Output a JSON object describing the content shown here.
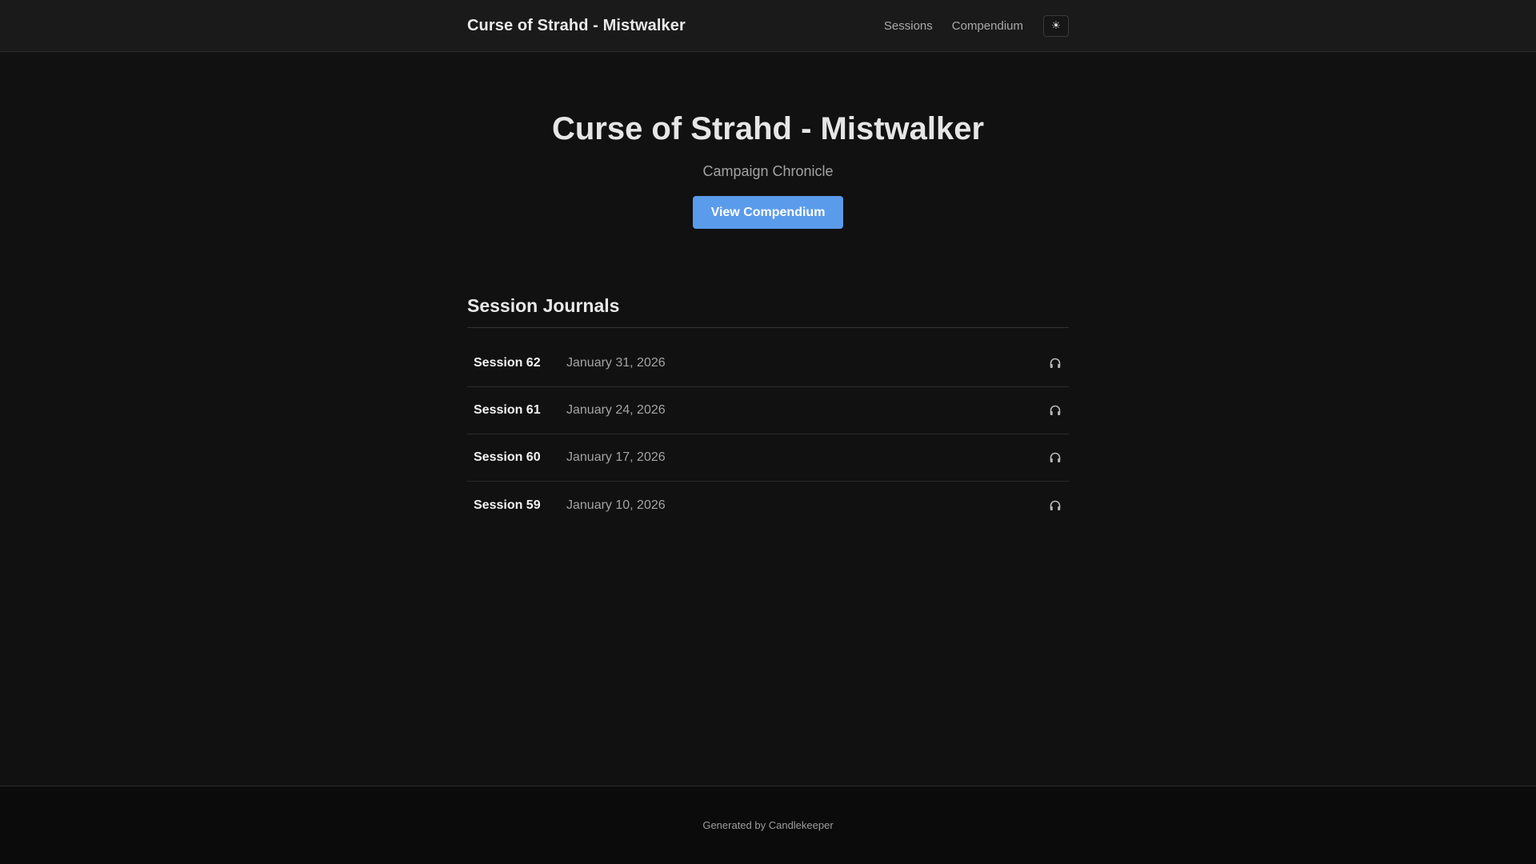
{
  "header": {
    "brand": "Curse of Strahd - Mistwalker",
    "nav": [
      "Sessions",
      "Compendium"
    ],
    "theme_toggle_icon": "sun-icon",
    "theme_toggle_glyph": "☀"
  },
  "hero": {
    "title": "Curse of Strahd - Mistwalker",
    "subtitle": "Campaign Chronicle",
    "cta_label": "View Compendium"
  },
  "journals": {
    "heading": "Session Journals",
    "sessions": [
      {
        "name": "Session 62",
        "date": "January 31, 2026",
        "icon": "headphones-icon"
      },
      {
        "name": "Session 61",
        "date": "January 24, 2026",
        "icon": "headphones-icon"
      },
      {
        "name": "Session 60",
        "date": "January 17, 2026",
        "icon": "headphones-icon"
      },
      {
        "name": "Session 59",
        "date": "January 10, 2026",
        "icon": "headphones-icon"
      }
    ]
  },
  "footer": {
    "text": "Generated by Candlekeeper"
  },
  "colors": {
    "accent": "#5b9bec",
    "background": "#111111",
    "header_bg": "#1a1a1a",
    "footer_bg": "#0b0b0b"
  }
}
